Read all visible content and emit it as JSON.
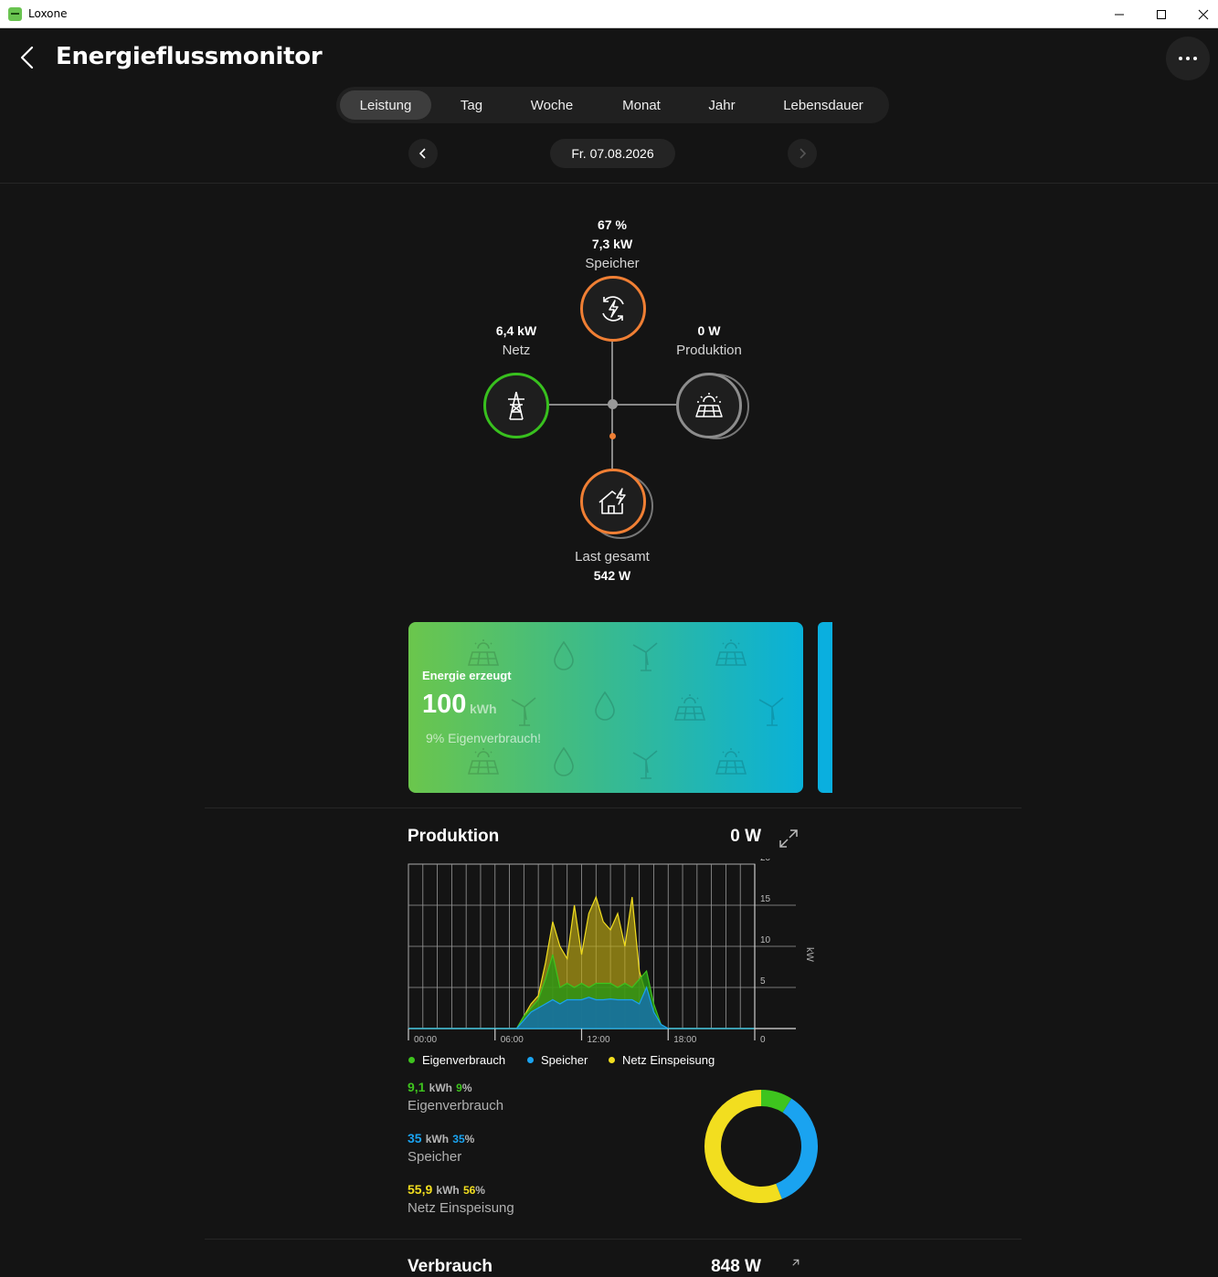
{
  "window": {
    "title": "Loxone"
  },
  "header": {
    "title": "Energieflussmonitor"
  },
  "tabs": [
    {
      "label": "Leistung",
      "active": true
    },
    {
      "label": "Tag"
    },
    {
      "label": "Woche"
    },
    {
      "label": "Monat"
    },
    {
      "label": "Jahr"
    },
    {
      "label": "Lebensdauer"
    }
  ],
  "date": "Fr. 07.08.2026",
  "flow": {
    "storage": {
      "percent": "67 %",
      "value": "7,3 kW",
      "label": "Speicher"
    },
    "grid": {
      "value": "6,4 kW",
      "label": "Netz"
    },
    "production": {
      "value": "0 W",
      "label": "Produktion"
    },
    "load": {
      "label": "Last gesamt",
      "value": "542 W"
    }
  },
  "energy_card": {
    "title": "Energie erzeugt",
    "value": "100",
    "unit": "kWh",
    "subtitle": "9% Eigenverbrauch!"
  },
  "production": {
    "title": "Produktion",
    "value": "0 W",
    "stats": [
      {
        "value": "9,1",
        "unit": "kWh",
        "percent": "9",
        "percent_unit": "%",
        "name": "Eigenverbrauch",
        "color": "#3ec41e"
      },
      {
        "value": "35",
        "unit": "kWh",
        "percent": "35",
        "percent_unit": "%",
        "name": "Speicher",
        "color": "#1aa3f0"
      },
      {
        "value": "55,9",
        "unit": "kWh",
        "percent": "56",
        "percent_unit": "%",
        "name": "Netz Einspeisung",
        "color": "#f2de1f"
      }
    ]
  },
  "next_section": {
    "title": "Verbrauch",
    "value": "848 W"
  },
  "chart_data": {
    "type": "area",
    "title": "",
    "xlabel": "",
    "ylabel": "kW",
    "x_tick_labels": [
      "00:00",
      "06:00",
      "12:00",
      "18:00"
    ],
    "y_tick_labels": [
      "0",
      "5",
      "10",
      "15",
      "20"
    ],
    "ylim": [
      0,
      20
    ],
    "x_hours": [
      0,
      7.5,
      8,
      8.5,
      9,
      9.5,
      10,
      10.5,
      11,
      11.5,
      12,
      12.5,
      13,
      13.5,
      14,
      14.5,
      15,
      15.5,
      16,
      16.5,
      17,
      17.5,
      18,
      24
    ],
    "series": [
      {
        "name": "Eigenverbrauch",
        "color": "#3ec41e",
        "values": [
          0,
          0,
          1.5,
          2.5,
          3.5,
          6,
          9,
          5,
          5.5,
          5,
          5.5,
          5,
          5.5,
          5.5,
          5.5,
          5,
          5.5,
          5,
          6,
          7,
          3,
          0.5,
          0,
          0
        ]
      },
      {
        "name": "Speicher",
        "color": "#1aa3f0",
        "values": [
          0,
          0,
          1,
          2,
          2.5,
          3,
          3.5,
          3,
          3.5,
          3.5,
          3.5,
          3.8,
          3.5,
          3.5,
          3.6,
          3.5,
          3.5,
          3.5,
          3,
          5,
          2,
          0.5,
          0,
          0
        ]
      },
      {
        "name": "Netz Einspeisung",
        "color": "#f2de1f",
        "values": [
          0,
          0,
          1.5,
          3,
          4,
          8,
          13,
          10,
          8.5,
          15,
          9,
          14,
          16,
          13,
          12,
          14,
          10,
          16,
          7,
          4,
          1.5,
          0.3,
          0,
          0
        ]
      }
    ]
  },
  "donut_data": {
    "type": "pie",
    "values": [
      9,
      35,
      56
    ],
    "labels": [
      "Eigenverbrauch",
      "Speicher",
      "Netz Einspeisung"
    ],
    "colors": [
      "#3ec41e",
      "#1aa3f0",
      "#f2de1f"
    ]
  }
}
